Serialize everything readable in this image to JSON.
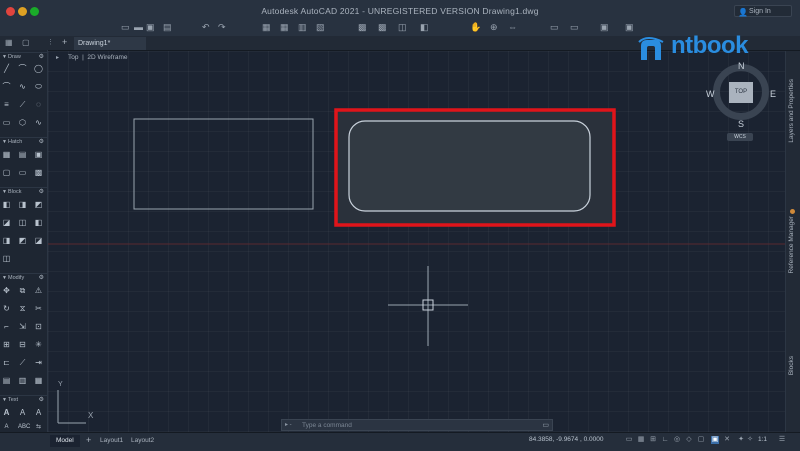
{
  "window": {
    "title": "Autodesk AutoCAD 2021 - UNREGISTERED VERSION    Drawing1.dwg",
    "signin_label": "Sign In"
  },
  "tabs": {
    "document": "Drawing1*"
  },
  "viewport": {
    "view": "Top",
    "style": "2D Wireframe"
  },
  "palette": {
    "sections": [
      "Draw",
      "Hatch",
      "Block",
      "Modify",
      "Text"
    ]
  },
  "viewcube": {
    "north": "N",
    "south": "S",
    "east": "E",
    "west": "W",
    "face": "TOP",
    "wcs": "WCS"
  },
  "right_panels": [
    "Layers and Properties",
    "Reference Manager",
    "Blocks"
  ],
  "command": {
    "prompt": "▸ -",
    "placeholder": "Type a command"
  },
  "layouts": [
    "Model",
    "Layout1",
    "Layout2"
  ],
  "status": {
    "coordinates": "84.3858, -9.9674 , 0.0000",
    "scale": "1:1"
  },
  "watermark": {
    "brand": "ntbook"
  },
  "colors": {
    "highlight": "#e0141a",
    "accent": "#2a8de0"
  },
  "ucs": {
    "x": "X",
    "y": "Y"
  }
}
